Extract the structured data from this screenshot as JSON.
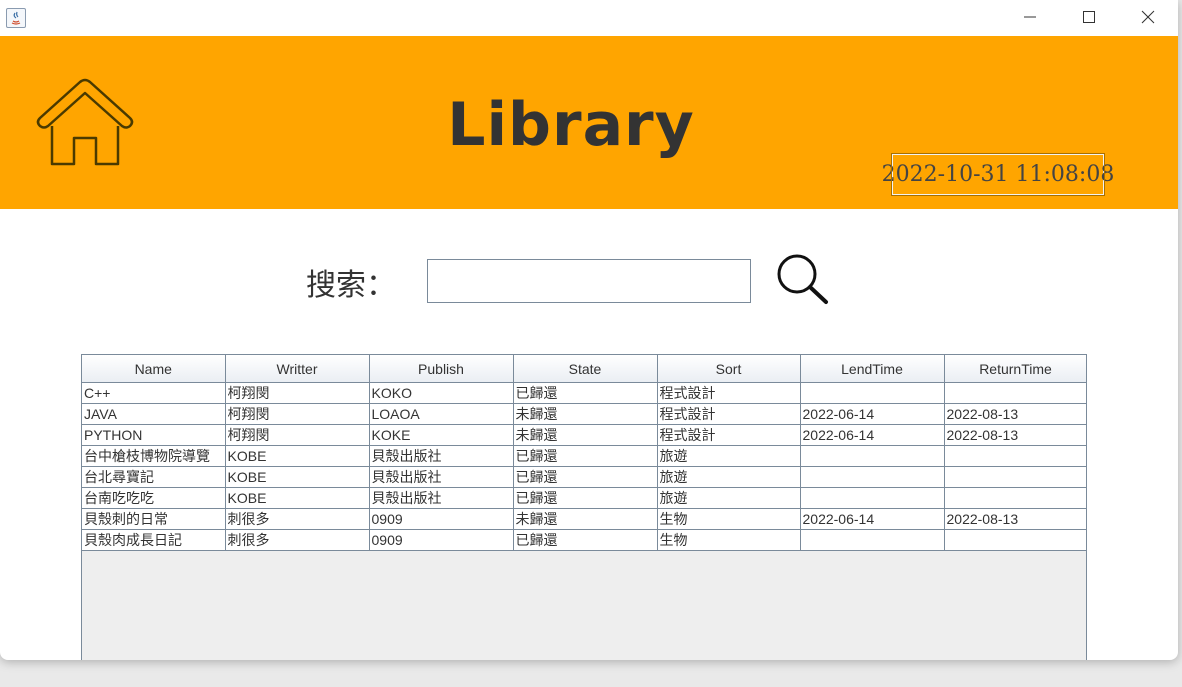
{
  "window": {
    "title": "",
    "controls": {
      "minimize": "minimize-icon",
      "maximize": "maximize-icon",
      "close": "close-icon"
    }
  },
  "header": {
    "background": "#ffa500",
    "title": "Library",
    "datetime": "2022-10-31 11:08:08",
    "home_icon": "home-icon"
  },
  "search": {
    "label": "搜索：",
    "value": "",
    "icon": "magnifier-icon"
  },
  "table": {
    "columns": [
      "Name",
      "Writter",
      "Publish",
      "State",
      "Sort",
      "LendTime",
      "ReturnTime"
    ],
    "rows": [
      [
        "C++",
        "柯翔閔",
        "KOKO",
        "已歸還",
        "程式設計",
        "",
        ""
      ],
      [
        "JAVA",
        "柯翔閔",
        "LOAOA",
        "未歸還",
        "程式設計",
        "2022-06-14",
        "2022-08-13"
      ],
      [
        "PYTHON",
        "柯翔閔",
        "KOKE",
        "未歸還",
        "程式設計",
        "2022-06-14",
        "2022-08-13"
      ],
      [
        "台中槍枝博物院導覽",
        "KOBE",
        "貝殼出版社",
        "已歸還",
        "旅遊",
        "",
        ""
      ],
      [
        "台北尋寶記",
        "KOBE",
        "貝殼出版社",
        "已歸還",
        "旅遊",
        "",
        ""
      ],
      [
        "台南吃吃吃",
        "KOBE",
        "貝殼出版社",
        "已歸還",
        "旅遊",
        "",
        ""
      ],
      [
        "貝殼刺的日常",
        "刺很多",
        "0909",
        "未歸還",
        "生物",
        "2022-06-14",
        "2022-08-13"
      ],
      [
        "貝殼肉成長日記",
        "刺很多",
        "0909",
        "已歸還",
        "生物",
        "",
        ""
      ]
    ]
  }
}
